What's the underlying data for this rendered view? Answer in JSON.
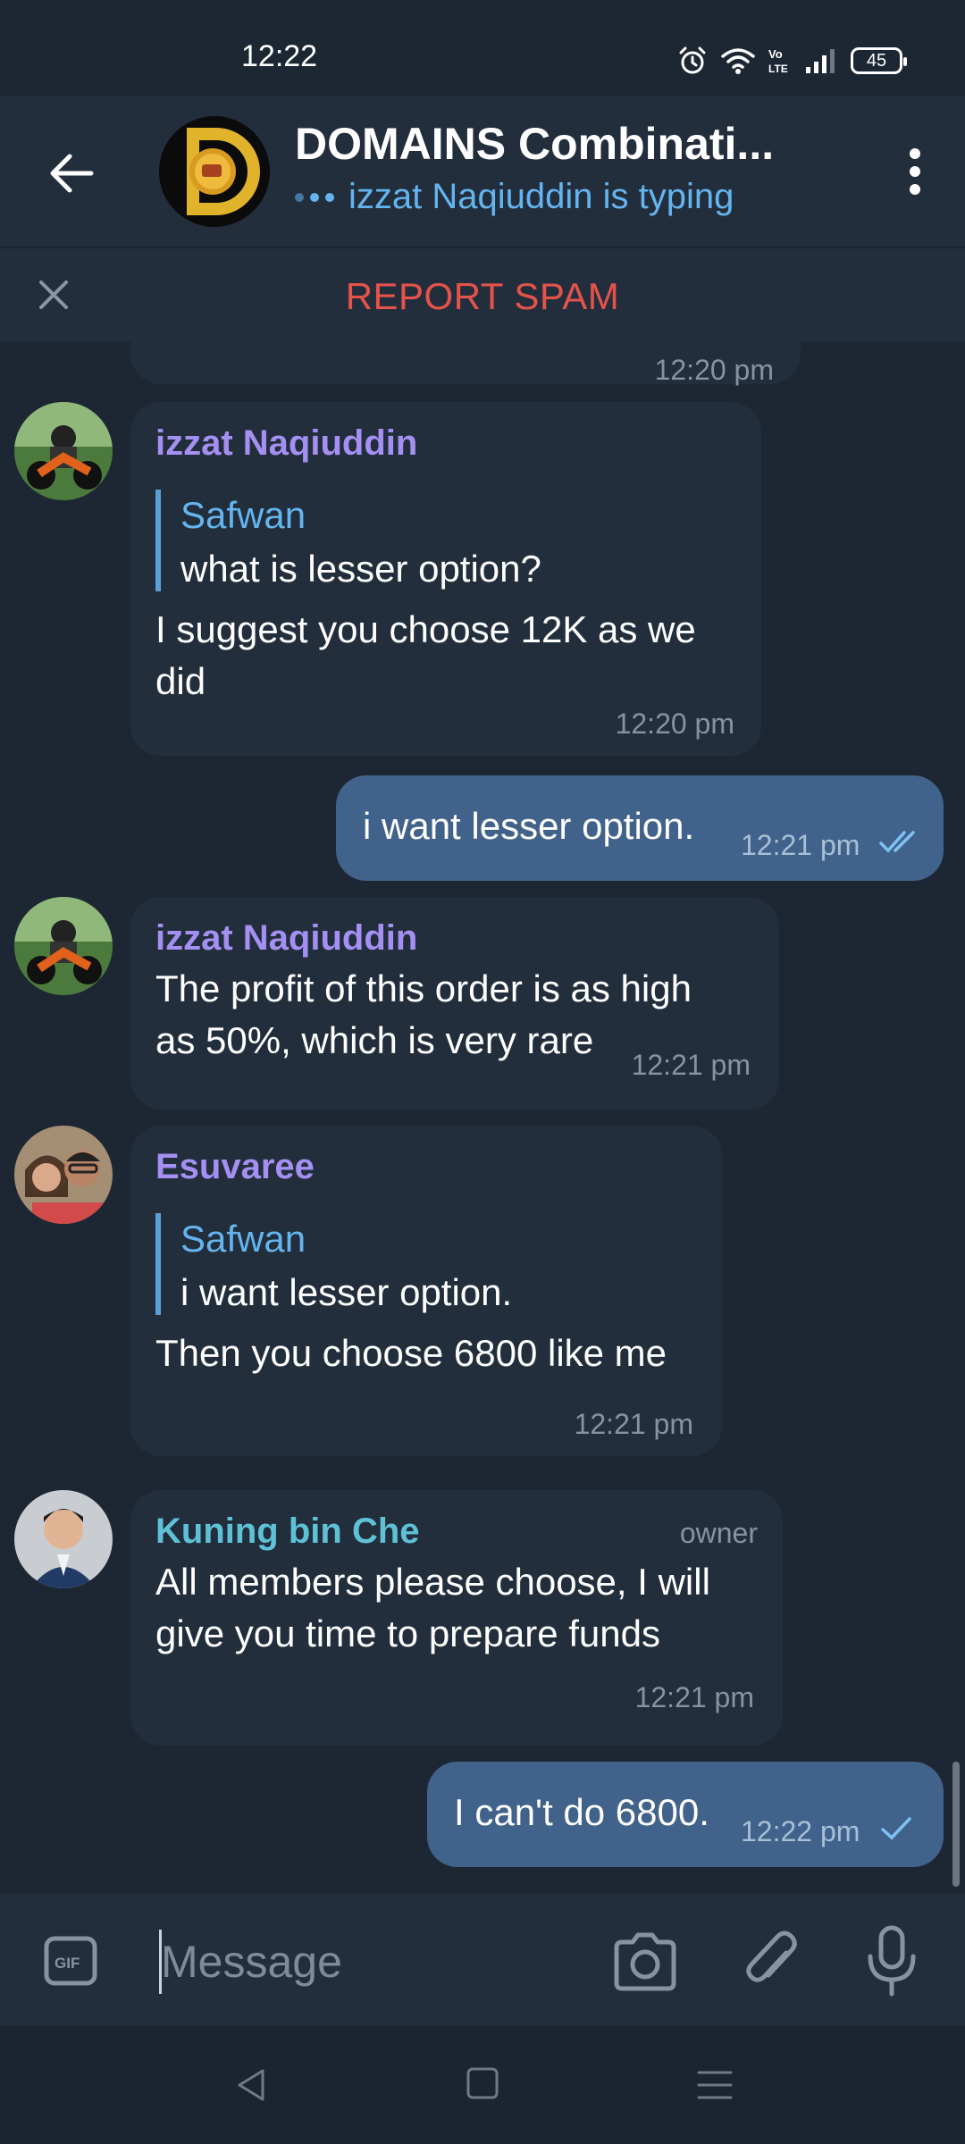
{
  "status_bar": {
    "time": "12:22",
    "battery": "45",
    "icons": [
      "alarm-icon",
      "wifi-icon",
      "volte-icon",
      "signal-icon",
      "battery-icon"
    ]
  },
  "header": {
    "title": "DOMAINS Combinati...",
    "typing_status": "izzat Naqiuddin is typing",
    "icons": [
      "back-arrow-icon",
      "group-avatar",
      "more-vertical-icon"
    ]
  },
  "spam_bar": {
    "label": "REPORT SPAM",
    "accent": "#e5534b"
  },
  "messages": [
    {
      "partial_time": "12:20 pm"
    },
    {
      "sender": "izzat Naqiuddin",
      "sender_color": "#a48ff2",
      "reply_to_name": "Safwan",
      "reply_to_text": "what is lesser option?",
      "text_line1": "I suggest you choose 12K as we",
      "text_line2": "did",
      "time": "12:20 pm"
    },
    {
      "outgoing": true,
      "text": "i want lesser option.",
      "time": "12:21 pm",
      "status": "read"
    },
    {
      "sender": "izzat Naqiuddin",
      "sender_color": "#a48ff2",
      "text_line1": "The profit of this order is as high",
      "text_line2": "as 50%, which is very rare",
      "time": "12:21 pm"
    },
    {
      "sender": "Esuvaree",
      "sender_color": "#a48ff2",
      "reply_to_name": "Safwan",
      "reply_to_text": "i want lesser option.",
      "text": "Then you choose 6800 like me",
      "time": "12:21 pm"
    },
    {
      "sender": "Kuning bin Che",
      "sender_color": "#5ec1d6",
      "role": "owner",
      "text_line1": "All members please choose, I will",
      "text_line2": "give you time to prepare funds",
      "time": "12:21 pm"
    },
    {
      "outgoing": true,
      "text": "I can't do 6800.",
      "time": "12:22 pm",
      "status": "sent"
    }
  ],
  "input_bar": {
    "placeholder": "Message",
    "icons": [
      "gif-icon",
      "camera-icon",
      "attach-icon",
      "mic-icon"
    ]
  },
  "nav_bar": {
    "icons": [
      "nav-back-icon",
      "nav-home-icon",
      "nav-recent-icon"
    ]
  },
  "colors": {
    "background": "#1d2733",
    "header": "#232e3c",
    "incoming_bubble": "#222e3b",
    "outgoing_bubble": "#41628a",
    "link_blue": "#64b5ef"
  }
}
